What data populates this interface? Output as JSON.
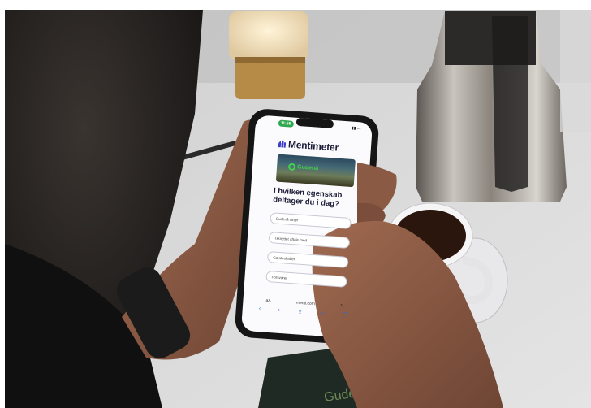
{
  "phone": {
    "status_time": "11:55",
    "brand": "Mentimeter",
    "banner_logo_text": "Gudenå",
    "question": "I hvilken egenskab deltager du i dag?",
    "options": [
      "Gudenå aktør",
      "Tilknyttet aftale med",
      "Gæsteskaber",
      "Forsvarer"
    ],
    "url": "menti.com",
    "url_left": "aA"
  },
  "colors": {
    "accent_green": "#3fd24b",
    "brand_indigo": "#3c3cc8"
  }
}
